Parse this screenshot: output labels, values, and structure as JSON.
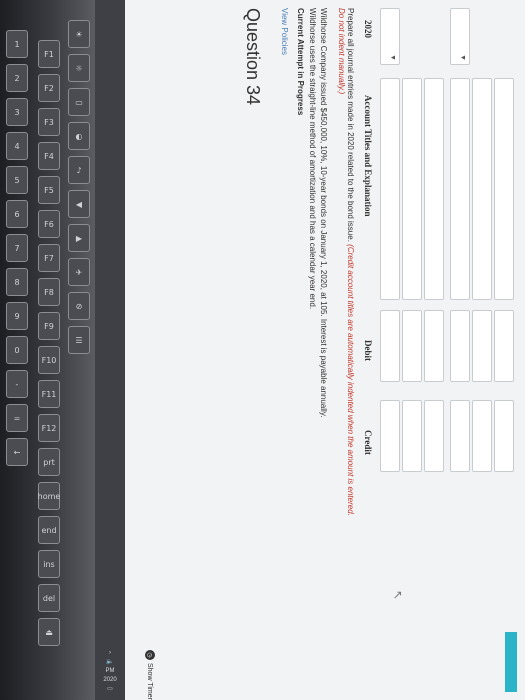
{
  "question": {
    "title": "Question 34",
    "view_policies": "View Policies",
    "attempt_status": "Current Attempt in Progress",
    "problem_text": "Wildhorse Company issued $450,000, 10%, 10-year bonds on January 1, 2020, at 105. Interest is payable annually. Wildhorse uses the straight-line method of amortization and has a calendar year end.",
    "instruction": "Prepare all journal entries made in 2020 related to the bond issue.",
    "instruction_note": "(Credit account titles are automatically indented when the amount is entered. Do not indent manually.)"
  },
  "table": {
    "headers": {
      "year": "2020",
      "account": "Account Titles and Explanation",
      "debit": "Debit",
      "credit": "Credit"
    }
  },
  "timer": {
    "label": "Show Timer"
  },
  "taskbar": {
    "time": "PM",
    "date": "2020"
  },
  "keys": [
    "F1",
    "F2",
    "F3",
    "F4",
    "F5",
    "F6",
    "F7",
    "F8",
    "F9",
    "F10",
    "F11",
    "F12",
    "prt",
    "home",
    "end",
    "ins",
    "del",
    "⏏"
  ]
}
